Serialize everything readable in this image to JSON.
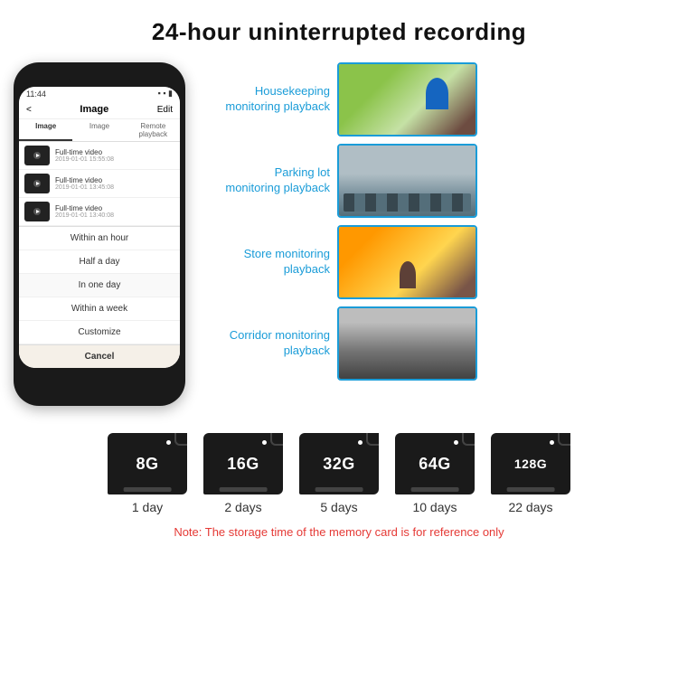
{
  "title": "24-hour uninterrupted recording",
  "phone": {
    "time": "11:44",
    "nav_back": "<",
    "nav_title": "Image",
    "nav_edit": "Edit",
    "tabs": [
      "Image",
      "Image",
      "Remote playback"
    ],
    "videos": [
      {
        "title": "Full-time video",
        "date": "2019-01-01 15:55:08"
      },
      {
        "title": "Full-time video",
        "date": "2019-01-01 13:45:08"
      },
      {
        "title": "Full-time video",
        "date": "2019-01-01 13:40:08"
      }
    ],
    "dropdown_items": [
      "Within an hour",
      "Half a day",
      "In one day",
      "Within a week",
      "Customize"
    ],
    "cancel": "Cancel"
  },
  "monitoring": [
    {
      "label": "Housekeeping\nmonitoring playback",
      "img_type": "housekeeping"
    },
    {
      "label": "Parking lot\nmonitoring playback",
      "img_type": "parking"
    },
    {
      "label": "Store monitoring\nplayback",
      "img_type": "store"
    },
    {
      "label": "Corridor monitoring\nplayback",
      "img_type": "corridor"
    }
  ],
  "storage": {
    "cards": [
      {
        "size": "8G",
        "days": "1 day"
      },
      {
        "size": "16G",
        "days": "2 days"
      },
      {
        "size": "32G",
        "days": "5 days"
      },
      {
        "size": "64G",
        "days": "10 days"
      },
      {
        "size": "128G",
        "days": "22 days"
      }
    ],
    "note": "Note: The storage time of the memory card is for reference only"
  }
}
